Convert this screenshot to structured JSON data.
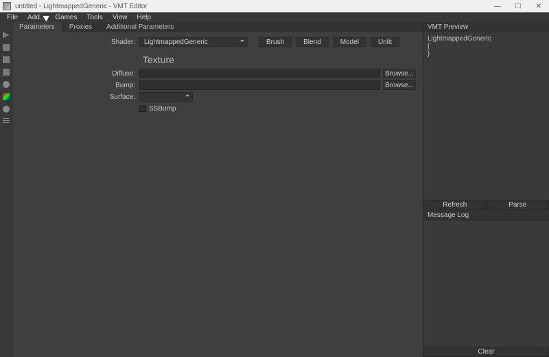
{
  "titlebar": {
    "text": "untitled - LightmappedGeneric - VMT Editor"
  },
  "menubar": {
    "items": [
      "File",
      "Add...",
      "Games",
      "Tools",
      "View",
      "Help"
    ]
  },
  "tabs": {
    "items": [
      "Parameters",
      "Proxies",
      "Additional Parameters"
    ],
    "active": 0
  },
  "shaderRow": {
    "label": "Shader:",
    "value": "LightmappedGeneric",
    "buttons": [
      "Brush",
      "Blend",
      "Model",
      "Unlit"
    ]
  },
  "section": {
    "title": "Texture"
  },
  "diffuse": {
    "label": "Diffuse:",
    "value": "",
    "browse": "Browse..."
  },
  "bump": {
    "label": "Bump:",
    "value": "",
    "browse": "Browse..."
  },
  "surface": {
    "label": "Surface:",
    "value": ""
  },
  "ssbump": {
    "label": "SSBump",
    "checked": false
  },
  "right": {
    "previewHeader": "VMT Preview",
    "previewText": "LightmappedGeneric\n{\n}",
    "refresh": "Refresh",
    "parse": "Parse",
    "logHeader": "Message Log",
    "clear": "Clear"
  }
}
